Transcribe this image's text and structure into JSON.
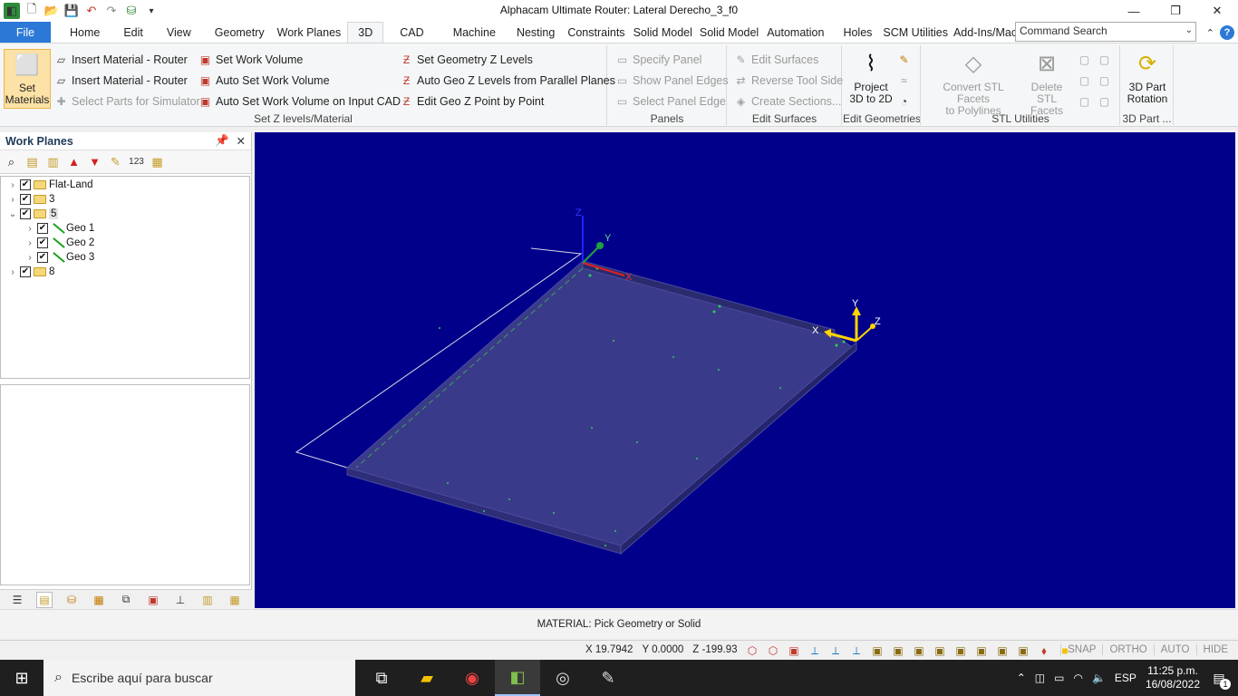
{
  "window": {
    "title": "Alphacam Ultimate Router: Lateral Derecho_3_f0",
    "minimize": "—",
    "restore": "❐",
    "close": "✕"
  },
  "qat": [
    "app-icon",
    "new-icon",
    "open-icon",
    "save-icon",
    "undo-icon",
    "redo-icon",
    "attribute-icon",
    "dropdown-icon"
  ],
  "tabs": [
    {
      "label": "File"
    },
    {
      "label": "Home"
    },
    {
      "label": "Edit"
    },
    {
      "label": "View"
    },
    {
      "label": "Geometry"
    },
    {
      "label": "Work Planes"
    },
    {
      "label": "3D"
    },
    {
      "label": "CAD"
    },
    {
      "label": "Machine"
    },
    {
      "label": "Nesting"
    },
    {
      "label": "Constraints"
    },
    {
      "label": "Solid Model"
    },
    {
      "label": "Solid Model"
    },
    {
      "label": "Automation"
    },
    {
      "label": "Holes"
    },
    {
      "label": "SCM Utilities"
    },
    {
      "label": "Add-Ins/Mac"
    }
  ],
  "active_tab": "3D",
  "command_search": {
    "placeholder": "Command Search"
  },
  "ribbon": {
    "set_z": {
      "label": "Set Z levels/Material",
      "set_materials": "Set Materials",
      "insert_material_1": "Insert Material - Router",
      "insert_material_2": "Insert Material - Router",
      "select_parts": "Select Parts for Simulator",
      "set_work_volume": "Set Work Volume",
      "auto_set_work_volume": "Auto Set Work Volume",
      "auto_set_work_volume_cad": "Auto Set Work Volume on Input CAD",
      "set_geometry_z": "Set Geometry Z Levels",
      "auto_geo_z": "Auto Geo Z Levels from Parallel Planes",
      "edit_geo_z": "Edit Geo Z Point by Point"
    },
    "panels": {
      "label": "Panels",
      "specify_panel": "Specify Panel",
      "show_panel_edges": "Show Panel Edges",
      "select_panel_edge": "Select Panel Edge"
    },
    "edit_surfaces": {
      "label": "Edit Surfaces",
      "edit_surfaces": "Edit Surfaces",
      "reverse_tool_side": "Reverse Tool Side",
      "create_sections": "Create Sections..."
    },
    "edit_geometries": {
      "label": "Edit Geometries",
      "project_line1": "Project",
      "project_line2": "3D to 2D"
    },
    "stl": {
      "label": "STL Utilities",
      "convert_line1": "Convert STL Facets",
      "convert_line2": "to Polylines",
      "delete_line1": "Delete STL",
      "delete_line2": "Facets"
    },
    "part": {
      "label": "3D Part ...",
      "rotation_line1": "3D Part",
      "rotation_line2": "Rotation"
    }
  },
  "work_planes": {
    "title": "Work Planes",
    "tree": [
      {
        "label": "Flat-Land",
        "type": "folder",
        "expanded": false,
        "checked": true,
        "level": 0
      },
      {
        "label": "3",
        "type": "folder",
        "expanded": false,
        "checked": true,
        "level": 0
      },
      {
        "label": "5",
        "type": "folder",
        "expanded": true,
        "checked": true,
        "level": 0,
        "selected": true
      },
      {
        "label": "Geo 1",
        "type": "geometry",
        "expanded": false,
        "checked": true,
        "level": 1
      },
      {
        "label": "Geo 2",
        "type": "geometry",
        "expanded": false,
        "checked": true,
        "level": 1
      },
      {
        "label": "Geo 3",
        "type": "geometry",
        "expanded": false,
        "checked": true,
        "level": 1
      },
      {
        "label": "8",
        "type": "folder",
        "expanded": false,
        "checked": true,
        "level": 0
      }
    ]
  },
  "viewport": {
    "background": "#00008b",
    "axis_labels": {
      "z": "Z",
      "y": "Y",
      "x": "X"
    },
    "gizmo_labels": {
      "y": "Y",
      "z": "Z",
      "x": "X"
    }
  },
  "prompt": "MATERIAL: Pick Geometry or Solid",
  "status": {
    "x": "X 19.7942",
    "y": "Y 0.0000",
    "z": "Z -199.93",
    "modes": [
      "SNAP",
      "ORTHO",
      "AUTO",
      "HIDE"
    ]
  },
  "taskbar": {
    "search_placeholder": "Escribe aquí para buscar",
    "language": "ESP",
    "time": "11:25 p.m.",
    "date": "16/08/2022",
    "notifications": "1"
  }
}
